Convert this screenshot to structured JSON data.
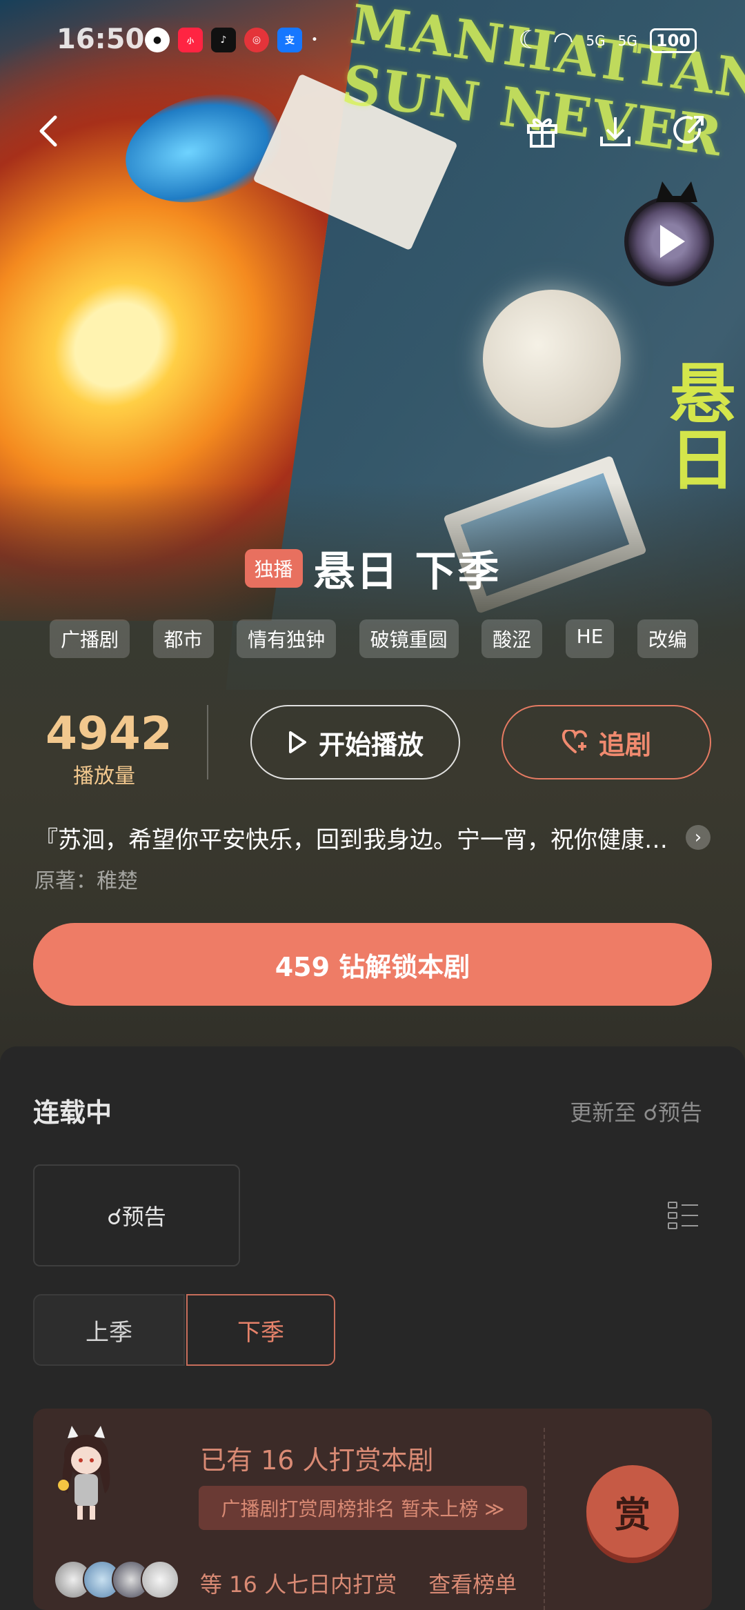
{
  "status_bar": {
    "time": "16:50",
    "battery": "100",
    "app_icons": [
      "qq-icon",
      "xiaohongshu-icon",
      "douyin-icon",
      "netease-music-icon",
      "alipay-icon"
    ],
    "network": [
      "5G",
      "5G"
    ]
  },
  "nav": {
    "back_icon": "chevron-left-icon",
    "gift_icon": "gift-icon",
    "download_icon": "download-icon",
    "share_icon": "share-icon"
  },
  "poster": {
    "text_en": "MANHATTAN SUN NEVER",
    "text_cn": "悬日"
  },
  "drama": {
    "badge": "独播",
    "title": "悬日 下季",
    "tags": [
      "广播剧",
      "都市",
      "情有独钟",
      "破镜重圆",
      "酸涩",
      "HE",
      "改编"
    ],
    "play_count": "4942",
    "play_count_label": "播放量",
    "play_button": "开始播放",
    "follow_button": "追剧",
    "description": "『苏洄，希望你平安快乐，回到我身边。宁一宵，祝你健康长寿，一生无忧。』",
    "author": "原著：稚楚",
    "unlock_button": "459 钻解锁本剧"
  },
  "episodes": {
    "status": "连载中",
    "update_info": "更新至 ☌预告",
    "episode_box": "☌预告",
    "seasons": [
      {
        "label": "上季",
        "active": false
      },
      {
        "label": "下季",
        "active": true
      }
    ]
  },
  "reward": {
    "title": "已有 16 人打赏本剧",
    "rank_tag": "广播剧打赏周榜排名 暂未上榜 ≫",
    "summary": "等 16 人七日内打赏",
    "view_list": "查看榜单",
    "button": "赏"
  },
  "colors": {
    "accent": "#ee7c66",
    "gold": "#f2c88e",
    "panel": "#272727"
  }
}
